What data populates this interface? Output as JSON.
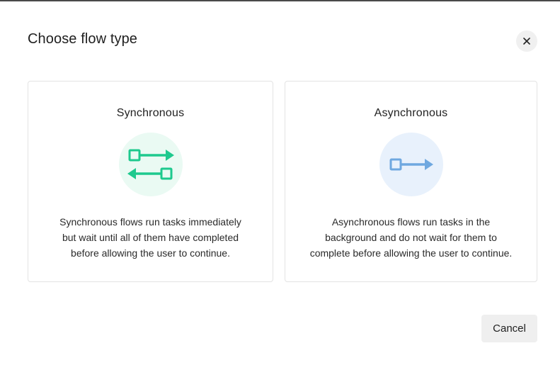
{
  "dialog": {
    "title": "Choose flow type",
    "close_icon": "close-icon",
    "cancel_label": "Cancel"
  },
  "options": [
    {
      "title": "Synchronous",
      "icon": "sync-arrows-icon",
      "icon_color": "#1ec98e",
      "icon_bg": "#eafaf3",
      "description": "Synchronous flows run tasks immediately but wait until all of them have completed before allowing the user to continue."
    },
    {
      "title": "Asynchronous",
      "icon": "async-arrow-icon",
      "icon_color": "#6fa8e0",
      "icon_bg": "#e8f1fc",
      "description": "Asynchronous flows run tasks in the background and do not wait for them to complete before allowing the user to continue."
    }
  ]
}
